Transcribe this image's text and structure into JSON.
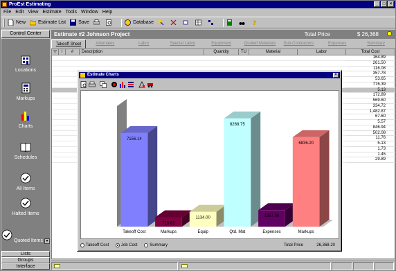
{
  "window": {
    "title": "ProEst Estimating"
  },
  "menu": [
    "File",
    "Edit",
    "View",
    "Estimate",
    "Tools",
    "Window",
    "Help"
  ],
  "toolbar": {
    "new_label": "New",
    "estimate_list_label": "Estimate List",
    "save_label": "Save",
    "database_label": "Database"
  },
  "control_center_label": "Control Center",
  "sidebar": {
    "items": [
      {
        "label": "Locations",
        "icon": "building-icon"
      },
      {
        "label": "Markups",
        "icon": "calculator-icon"
      },
      {
        "label": "Charts",
        "icon": "bar-chart-icon"
      },
      {
        "label": "Schedules",
        "icon": "book-icon"
      },
      {
        "label": "All Items",
        "icon": "check-icon"
      },
      {
        "label": "Halted Items",
        "icon": "check-icon"
      },
      {
        "label": "Quoted Items",
        "icon": "check-icon"
      }
    ],
    "bottom_buttons": [
      "Lists",
      "Groups",
      "Interface"
    ]
  },
  "estimate": {
    "title": "Estimate #2  Johnson Project",
    "total_price_label": "Total Price",
    "total_price_value": "$ 26,368"
  },
  "tabs": [
    "Takeoff Sheet",
    "Alternates",
    "Labor",
    "Special Labor",
    "Equipment",
    "Quoted Materials",
    "Sub-Contractors",
    "Expenses",
    "Summary"
  ],
  "grid": {
    "headers": [
      "Description",
      "Quantity",
      "TU",
      "Material",
      "Labor",
      "Total Cost"
    ],
    "total_cost": [
      "164.89",
      "261.50",
      "116.08",
      "357.78",
      "53.65",
      "776.39",
      "5.13",
      "172.89",
      "569.60",
      "334.72",
      "1,482.87",
      "67.60",
      "5.57",
      "846.94",
      "502.08",
      "11.76",
      "5.13",
      "1.73",
      "1.45",
      "29.89"
    ],
    "selected_index": 6
  },
  "dialog": {
    "title": "Estimate Charts",
    "radios": [
      {
        "label": "Takeoff Cost",
        "checked": false
      },
      {
        "label": "Job Cost",
        "checked": true
      },
      {
        "label": "Summary",
        "checked": false
      }
    ],
    "total_price_label": "Total Price",
    "total_price_value": "26,368.20"
  },
  "chart_data": {
    "type": "bar",
    "categories": [
      "Takeoff Cost",
      "Markups",
      "Equip",
      "Qtd. Mat",
      "Expenses",
      "Markups"
    ],
    "values": [
      7156.14,
      715.61,
      1134.0,
      8268.75,
      1257.86,
      6836.2
    ],
    "value_labels": [
      "7156.14",
      "715.61",
      "1134.00",
      "8268.75",
      "1257.86",
      "6836.20"
    ],
    "colors": [
      "#8080ff",
      "#800040",
      "#ffffc0",
      "#c0ffff",
      "#600060",
      "#ff8080"
    ],
    "ylim": [
      0,
      9000
    ],
    "grid": false,
    "three_d": true
  }
}
